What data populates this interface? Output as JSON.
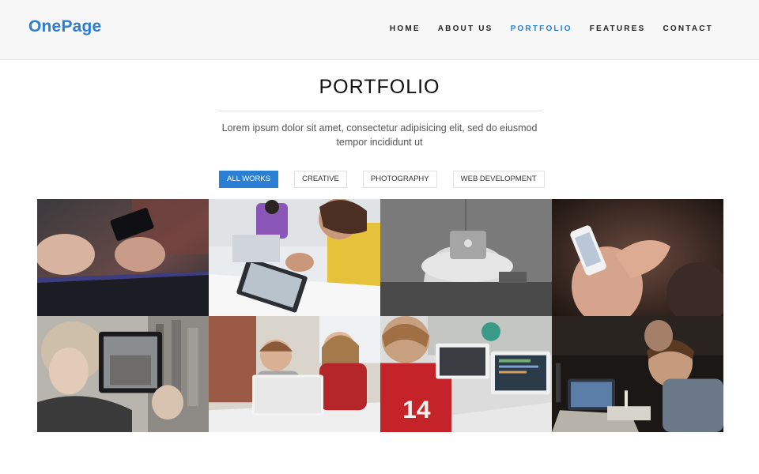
{
  "header": {
    "logo": "OnePage",
    "nav": [
      {
        "label": "HOME",
        "active": false
      },
      {
        "label": "ABOUT US",
        "active": false
      },
      {
        "label": "PORTFOLIO",
        "active": true
      },
      {
        "label": "FEATURES",
        "active": false
      },
      {
        "label": "CONTACT",
        "active": false
      }
    ]
  },
  "section": {
    "title": "PORTFOLIO",
    "description": "Lorem ipsum dolor sit amet, consectetur adipisicing elit, sed do eiusmod tempor incididunt ut"
  },
  "filters": [
    {
      "label": "ALL WORKS",
      "active": true
    },
    {
      "label": "CREATIVE",
      "active": false
    },
    {
      "label": "PHOTOGRAPHY",
      "active": false
    },
    {
      "label": "WEB DEVELOPMENT",
      "active": false
    }
  ],
  "colors": {
    "accent": "#2a7fd4",
    "header_bg": "#f7f7f7"
  },
  "portfolio": {
    "items": [
      {
        "icon": "photo-hands-phone-laptop"
      },
      {
        "icon": "photo-man-drawing-tablet"
      },
      {
        "icon": "photo-laptop-on-chair"
      },
      {
        "icon": "photo-hand-holding-phone"
      },
      {
        "icon": "photo-woman-tablet-city"
      },
      {
        "icon": "photo-kids-laptop"
      },
      {
        "icon": "photo-boy-laptops"
      },
      {
        "icon": "photo-man-laptop-dark"
      }
    ]
  }
}
